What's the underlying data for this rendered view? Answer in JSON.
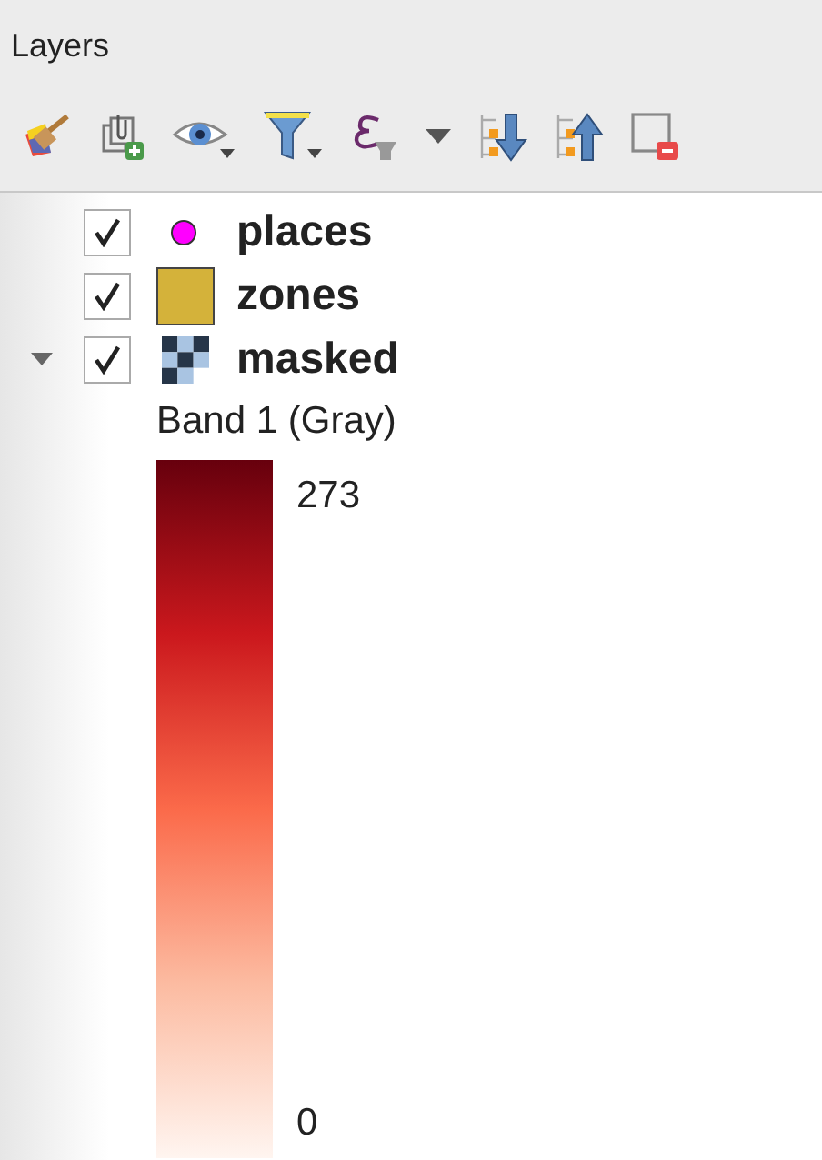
{
  "panel": {
    "title": "Layers"
  },
  "toolbar": [
    {
      "kind": "style"
    },
    {
      "kind": "add-group"
    },
    {
      "kind": "visibility"
    },
    {
      "kind": "filter"
    },
    {
      "kind": "expression"
    },
    {
      "kind": "menu"
    },
    {
      "kind": "expand"
    },
    {
      "kind": "collapse"
    },
    {
      "kind": "remove"
    }
  ],
  "layers": [
    {
      "name": "places",
      "checked": true,
      "kind": "point",
      "color": "#ff00ff"
    },
    {
      "name": "zones",
      "checked": true,
      "kind": "polygon",
      "color": "#d4b23a"
    },
    {
      "name": "masked",
      "checked": true,
      "kind": "raster",
      "expanded": true,
      "legend": {
        "title": "Band 1 (Gray)",
        "max": "273",
        "min": "0"
      }
    }
  ]
}
